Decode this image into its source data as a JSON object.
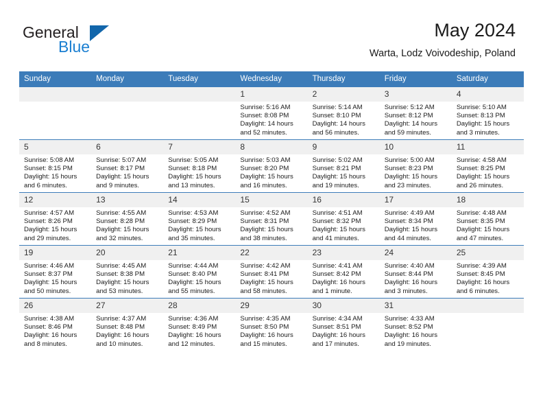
{
  "brand": {
    "name_part1": "General",
    "name_part2": "Blue",
    "logo_icon": "blue-triangle-icon"
  },
  "header": {
    "title": "May 2024",
    "subtitle": "Warta, Lodz Voivodeship, Poland"
  },
  "calendar": {
    "weekday_headers": [
      "Sunday",
      "Monday",
      "Tuesday",
      "Wednesday",
      "Thursday",
      "Friday",
      "Saturday"
    ],
    "accent_color": "#3c7cb9",
    "daynum_band_color": "#f0f0f0",
    "weeks": [
      [
        {
          "day": "",
          "empty": true,
          "sunrise": "",
          "sunset": "",
          "daylight_line1": "",
          "daylight_line2": ""
        },
        {
          "day": "",
          "empty": true,
          "sunrise": "",
          "sunset": "",
          "daylight_line1": "",
          "daylight_line2": ""
        },
        {
          "day": "",
          "empty": true,
          "sunrise": "",
          "sunset": "",
          "daylight_line1": "",
          "daylight_line2": ""
        },
        {
          "day": "1",
          "empty": false,
          "sunrise": "Sunrise: 5:16 AM",
          "sunset": "Sunset: 8:08 PM",
          "daylight_line1": "Daylight: 14 hours",
          "daylight_line2": "and 52 minutes."
        },
        {
          "day": "2",
          "empty": false,
          "sunrise": "Sunrise: 5:14 AM",
          "sunset": "Sunset: 8:10 PM",
          "daylight_line1": "Daylight: 14 hours",
          "daylight_line2": "and 56 minutes."
        },
        {
          "day": "3",
          "empty": false,
          "sunrise": "Sunrise: 5:12 AM",
          "sunset": "Sunset: 8:12 PM",
          "daylight_line1": "Daylight: 14 hours",
          "daylight_line2": "and 59 minutes."
        },
        {
          "day": "4",
          "empty": false,
          "sunrise": "Sunrise: 5:10 AM",
          "sunset": "Sunset: 8:13 PM",
          "daylight_line1": "Daylight: 15 hours",
          "daylight_line2": "and 3 minutes."
        }
      ],
      [
        {
          "day": "5",
          "empty": false,
          "sunrise": "Sunrise: 5:08 AM",
          "sunset": "Sunset: 8:15 PM",
          "daylight_line1": "Daylight: 15 hours",
          "daylight_line2": "and 6 minutes."
        },
        {
          "day": "6",
          "empty": false,
          "sunrise": "Sunrise: 5:07 AM",
          "sunset": "Sunset: 8:17 PM",
          "daylight_line1": "Daylight: 15 hours",
          "daylight_line2": "and 9 minutes."
        },
        {
          "day": "7",
          "empty": false,
          "sunrise": "Sunrise: 5:05 AM",
          "sunset": "Sunset: 8:18 PM",
          "daylight_line1": "Daylight: 15 hours",
          "daylight_line2": "and 13 minutes."
        },
        {
          "day": "8",
          "empty": false,
          "sunrise": "Sunrise: 5:03 AM",
          "sunset": "Sunset: 8:20 PM",
          "daylight_line1": "Daylight: 15 hours",
          "daylight_line2": "and 16 minutes."
        },
        {
          "day": "9",
          "empty": false,
          "sunrise": "Sunrise: 5:02 AM",
          "sunset": "Sunset: 8:21 PM",
          "daylight_line1": "Daylight: 15 hours",
          "daylight_line2": "and 19 minutes."
        },
        {
          "day": "10",
          "empty": false,
          "sunrise": "Sunrise: 5:00 AM",
          "sunset": "Sunset: 8:23 PM",
          "daylight_line1": "Daylight: 15 hours",
          "daylight_line2": "and 23 minutes."
        },
        {
          "day": "11",
          "empty": false,
          "sunrise": "Sunrise: 4:58 AM",
          "sunset": "Sunset: 8:25 PM",
          "daylight_line1": "Daylight: 15 hours",
          "daylight_line2": "and 26 minutes."
        }
      ],
      [
        {
          "day": "12",
          "empty": false,
          "sunrise": "Sunrise: 4:57 AM",
          "sunset": "Sunset: 8:26 PM",
          "daylight_line1": "Daylight: 15 hours",
          "daylight_line2": "and 29 minutes."
        },
        {
          "day": "13",
          "empty": false,
          "sunrise": "Sunrise: 4:55 AM",
          "sunset": "Sunset: 8:28 PM",
          "daylight_line1": "Daylight: 15 hours",
          "daylight_line2": "and 32 minutes."
        },
        {
          "day": "14",
          "empty": false,
          "sunrise": "Sunrise: 4:53 AM",
          "sunset": "Sunset: 8:29 PM",
          "daylight_line1": "Daylight: 15 hours",
          "daylight_line2": "and 35 minutes."
        },
        {
          "day": "15",
          "empty": false,
          "sunrise": "Sunrise: 4:52 AM",
          "sunset": "Sunset: 8:31 PM",
          "daylight_line1": "Daylight: 15 hours",
          "daylight_line2": "and 38 minutes."
        },
        {
          "day": "16",
          "empty": false,
          "sunrise": "Sunrise: 4:51 AM",
          "sunset": "Sunset: 8:32 PM",
          "daylight_line1": "Daylight: 15 hours",
          "daylight_line2": "and 41 minutes."
        },
        {
          "day": "17",
          "empty": false,
          "sunrise": "Sunrise: 4:49 AM",
          "sunset": "Sunset: 8:34 PM",
          "daylight_line1": "Daylight: 15 hours",
          "daylight_line2": "and 44 minutes."
        },
        {
          "day": "18",
          "empty": false,
          "sunrise": "Sunrise: 4:48 AM",
          "sunset": "Sunset: 8:35 PM",
          "daylight_line1": "Daylight: 15 hours",
          "daylight_line2": "and 47 minutes."
        }
      ],
      [
        {
          "day": "19",
          "empty": false,
          "sunrise": "Sunrise: 4:46 AM",
          "sunset": "Sunset: 8:37 PM",
          "daylight_line1": "Daylight: 15 hours",
          "daylight_line2": "and 50 minutes."
        },
        {
          "day": "20",
          "empty": false,
          "sunrise": "Sunrise: 4:45 AM",
          "sunset": "Sunset: 8:38 PM",
          "daylight_line1": "Daylight: 15 hours",
          "daylight_line2": "and 53 minutes."
        },
        {
          "day": "21",
          "empty": false,
          "sunrise": "Sunrise: 4:44 AM",
          "sunset": "Sunset: 8:40 PM",
          "daylight_line1": "Daylight: 15 hours",
          "daylight_line2": "and 55 minutes."
        },
        {
          "day": "22",
          "empty": false,
          "sunrise": "Sunrise: 4:42 AM",
          "sunset": "Sunset: 8:41 PM",
          "daylight_line1": "Daylight: 15 hours",
          "daylight_line2": "and 58 minutes."
        },
        {
          "day": "23",
          "empty": false,
          "sunrise": "Sunrise: 4:41 AM",
          "sunset": "Sunset: 8:42 PM",
          "daylight_line1": "Daylight: 16 hours",
          "daylight_line2": "and 1 minute."
        },
        {
          "day": "24",
          "empty": false,
          "sunrise": "Sunrise: 4:40 AM",
          "sunset": "Sunset: 8:44 PM",
          "daylight_line1": "Daylight: 16 hours",
          "daylight_line2": "and 3 minutes."
        },
        {
          "day": "25",
          "empty": false,
          "sunrise": "Sunrise: 4:39 AM",
          "sunset": "Sunset: 8:45 PM",
          "daylight_line1": "Daylight: 16 hours",
          "daylight_line2": "and 6 minutes."
        }
      ],
      [
        {
          "day": "26",
          "empty": false,
          "sunrise": "Sunrise: 4:38 AM",
          "sunset": "Sunset: 8:46 PM",
          "daylight_line1": "Daylight: 16 hours",
          "daylight_line2": "and 8 minutes."
        },
        {
          "day": "27",
          "empty": false,
          "sunrise": "Sunrise: 4:37 AM",
          "sunset": "Sunset: 8:48 PM",
          "daylight_line1": "Daylight: 16 hours",
          "daylight_line2": "and 10 minutes."
        },
        {
          "day": "28",
          "empty": false,
          "sunrise": "Sunrise: 4:36 AM",
          "sunset": "Sunset: 8:49 PM",
          "daylight_line1": "Daylight: 16 hours",
          "daylight_line2": "and 12 minutes."
        },
        {
          "day": "29",
          "empty": false,
          "sunrise": "Sunrise: 4:35 AM",
          "sunset": "Sunset: 8:50 PM",
          "daylight_line1": "Daylight: 16 hours",
          "daylight_line2": "and 15 minutes."
        },
        {
          "day": "30",
          "empty": false,
          "sunrise": "Sunrise: 4:34 AM",
          "sunset": "Sunset: 8:51 PM",
          "daylight_line1": "Daylight: 16 hours",
          "daylight_line2": "and 17 minutes."
        },
        {
          "day": "31",
          "empty": false,
          "sunrise": "Sunrise: 4:33 AM",
          "sunset": "Sunset: 8:52 PM",
          "daylight_line1": "Daylight: 16 hours",
          "daylight_line2": "and 19 minutes."
        },
        {
          "day": "",
          "empty": true,
          "sunrise": "",
          "sunset": "",
          "daylight_line1": "",
          "daylight_line2": ""
        }
      ]
    ]
  }
}
